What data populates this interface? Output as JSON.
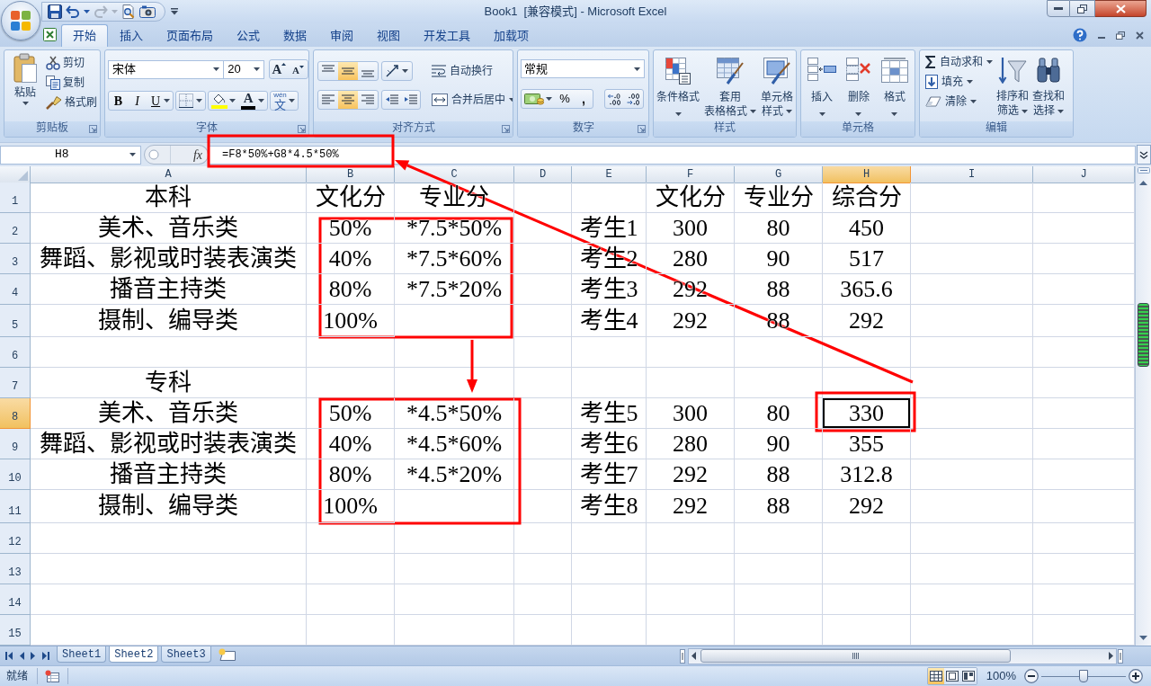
{
  "window": {
    "title": "Book1  [兼容模式] - Microsoft Excel"
  },
  "quick_access": [
    {
      "kind": "save",
      "disabled": false
    },
    {
      "kind": "undo",
      "disabled": false
    },
    {
      "kind": "redo",
      "disabled": true
    },
    {
      "kind": "print_preview",
      "disabled": false
    },
    {
      "kind": "camera",
      "disabled": false
    }
  ],
  "ribbon_tabs": [
    {
      "label": "开始",
      "selected": true
    },
    {
      "label": "插入",
      "selected": false
    },
    {
      "label": "页面布局",
      "selected": false
    },
    {
      "label": "公式",
      "selected": false
    },
    {
      "label": "数据",
      "selected": false
    },
    {
      "label": "审阅",
      "selected": false
    },
    {
      "label": "视图",
      "selected": false
    },
    {
      "label": "开发工具",
      "selected": false
    },
    {
      "label": "加载项",
      "selected": false
    }
  ],
  "ribbon": {
    "clipboard": {
      "label": "剪贴板",
      "paste": "粘贴",
      "commands": [
        {
          "kind": "cut",
          "label": "剪切"
        },
        {
          "kind": "copy",
          "label": "复制"
        },
        {
          "kind": "format_painter",
          "label": "格式刷"
        }
      ]
    },
    "font": {
      "label": "字体",
      "font_name": "宋体",
      "font_size": "20",
      "grow_font": "A",
      "shrink_font": "A",
      "bold": "B",
      "italic": "I",
      "underline": "U",
      "font_color": "A",
      "phonetic_ruby": "wén",
      "phonetic_base": "文"
    },
    "alignment": {
      "label": "对齐方式",
      "vertical": [
        {
          "kind": "top",
          "selected": false
        },
        {
          "kind": "middle",
          "selected": true
        },
        {
          "kind": "bottom",
          "selected": false
        }
      ],
      "horizontal": [
        {
          "kind": "left",
          "selected": false
        },
        {
          "kind": "center",
          "selected": true
        },
        {
          "kind": "right",
          "selected": false
        }
      ],
      "wrap_text": "自动换行",
      "merge_center": "合并后居中"
    },
    "number": {
      "label": "数字",
      "format": "常规",
      "percent": "%",
      "comma": ","
    },
    "styles": {
      "label": "样式",
      "commands": [
        {
          "kind": "conditional",
          "lines": [
            "条件格式"
          ]
        },
        {
          "kind": "table",
          "lines": [
            "套用",
            "表格格式"
          ]
        },
        {
          "kind": "cell_styles",
          "lines": [
            "单元格",
            "样式"
          ]
        }
      ]
    },
    "cells": {
      "label": "单元格",
      "commands": [
        {
          "kind": "insert",
          "lines": [
            "插入"
          ]
        },
        {
          "kind": "delete",
          "lines": [
            "删除"
          ]
        },
        {
          "kind": "format",
          "lines": [
            "格式"
          ]
        }
      ]
    },
    "editing": {
      "label": "编辑",
      "commands": [
        {
          "kind": "autosum",
          "label": "自动求和"
        },
        {
          "kind": "fill",
          "label": "填充"
        },
        {
          "kind": "clear",
          "label": "清除"
        }
      ],
      "large_commands": [
        {
          "kind": "sort",
          "lines": [
            "排序和",
            "筛选"
          ]
        },
        {
          "kind": "find",
          "lines": [
            "查找和",
            "选择"
          ]
        }
      ]
    }
  },
  "formula_bar": {
    "name_box": "H8",
    "function_label": "fx",
    "formula": "=F8*50%+G8*4.5*50%"
  },
  "sheet": {
    "columns": [
      {
        "label": "A",
        "selected": false
      },
      {
        "label": "B",
        "selected": false
      },
      {
        "label": "C",
        "selected": false
      },
      {
        "label": "D",
        "selected": false
      },
      {
        "label": "E",
        "selected": false
      },
      {
        "label": "F",
        "selected": false
      },
      {
        "label": "G",
        "selected": false
      },
      {
        "label": "H",
        "selected": true
      },
      {
        "label": "I",
        "selected": false
      },
      {
        "label": "J",
        "selected": false
      }
    ],
    "rows": [
      {
        "label": "1",
        "selected": false,
        "cells": [
          "本科",
          "文化分",
          "专业分",
          null,
          null,
          "文化分",
          "专业分",
          "综合分"
        ]
      },
      {
        "label": "2",
        "selected": false,
        "cells": [
          "美术、音乐类",
          "50%",
          "*7.5*50%",
          null,
          "考生1",
          "300",
          "80",
          "450"
        ]
      },
      {
        "label": "3",
        "selected": false,
        "cells": [
          "舞蹈、影视或时装表演类",
          "40%",
          "*7.5*60%",
          null,
          "考生2",
          "280",
          "90",
          "517"
        ]
      },
      {
        "label": "4",
        "selected": false,
        "cells": [
          "播音主持类",
          "80%",
          "*7.5*20%",
          null,
          "考生3",
          "292",
          "88",
          "365.6"
        ]
      },
      {
        "label": "5",
        "selected": false,
        "cells": [
          "摄制、编导类",
          "100%",
          null,
          null,
          "考生4",
          "292",
          "88",
          "292"
        ]
      },
      {
        "label": "6",
        "selected": false
      },
      {
        "label": "7",
        "selected": false,
        "cells": [
          "专科"
        ]
      },
      {
        "label": "8",
        "selected": true,
        "cells": [
          "美术、音乐类",
          "50%",
          "*4.5*50%",
          null,
          "考生5",
          "300",
          "80",
          "330"
        ]
      },
      {
        "label": "9",
        "selected": false,
        "cells": [
          "舞蹈、影视或时装表演类",
          "40%",
          "*4.5*60%",
          null,
          "考生6",
          "280",
          "90",
          "355"
        ]
      },
      {
        "label": "10",
        "selected": false,
        "cells": [
          "播音主持类",
          "80%",
          "*4.5*20%",
          null,
          "考生7",
          "292",
          "88",
          "312.8"
        ]
      },
      {
        "label": "11",
        "selected": false,
        "cells": [
          "摄制、编导类",
          "100%",
          null,
          null,
          "考生8",
          "292",
          "88",
          "292"
        ]
      },
      {
        "label": "12",
        "selected": false
      },
      {
        "label": "13",
        "selected": false
      },
      {
        "label": "14",
        "selected": false
      },
      {
        "label": "15",
        "selected": false
      }
    ]
  },
  "sheet_tabs": [
    {
      "label": "Sheet1",
      "selected": false
    },
    {
      "label": "Sheet2",
      "selected": true
    },
    {
      "label": "Sheet3",
      "selected": false
    }
  ],
  "status_bar": {
    "status": "就绪",
    "view_buttons": [
      {
        "kind": "normal",
        "selected": true
      },
      {
        "kind": "page_layout",
        "selected": false
      },
      {
        "kind": "page_break",
        "selected": false
      }
    ],
    "zoom": "100%",
    "zoom_slider": {
      "level": 0.5
    }
  }
}
